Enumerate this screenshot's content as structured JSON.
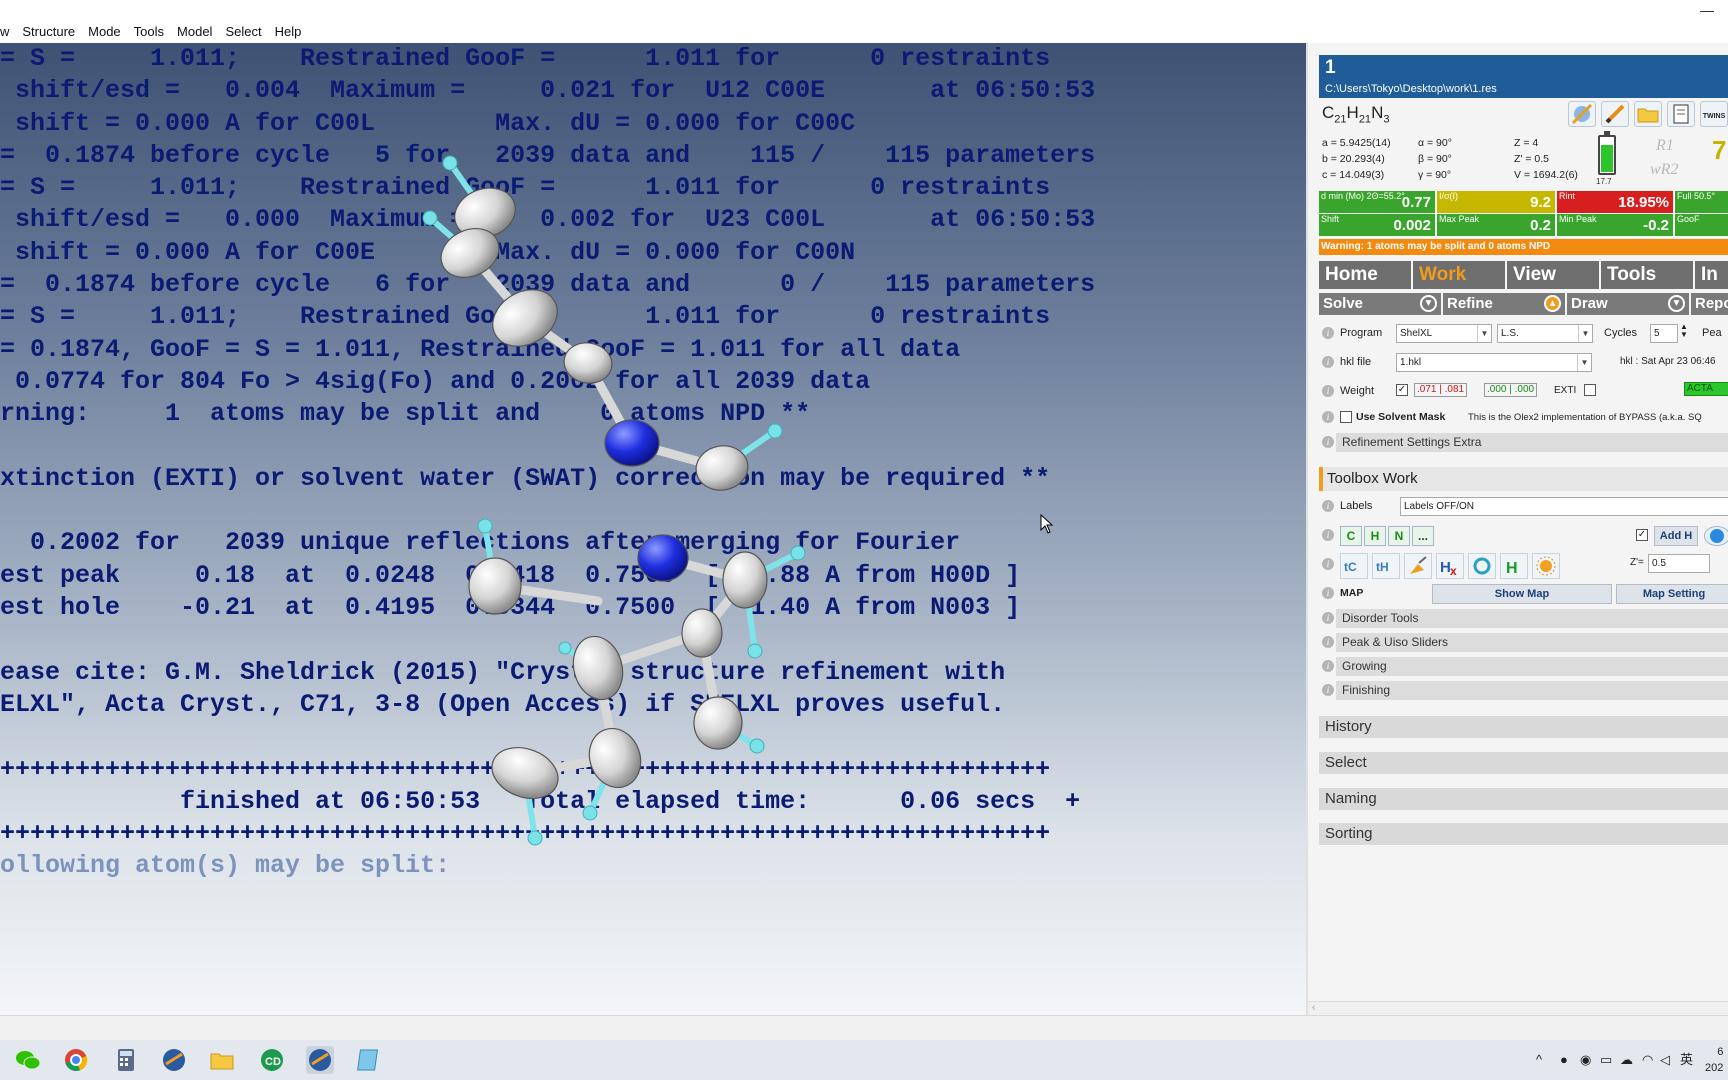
{
  "menu": {
    "items": [
      "w",
      "Structure",
      "Mode",
      "Tools",
      "Model",
      "Select",
      "Help"
    ]
  },
  "console": {
    "lines": [
      "= S =     1.011;    Restrained GooF =      1.011 for      0 restraints",
      " shift/esd =   0.004  Maximum =     0.021 for  U12 C00E       at 06:50:53",
      " shift = 0.000 A for C00L        Max. dU = 0.000 for C00C",
      "=  0.1874 before cycle   5 for   2039 data and    115 /    115 parameters",
      "= S =     1.011;    Restrained GooF =      1.011 for      0 restraints",
      " shift/esd =   0.000  Maximum =     0.002 for  U23 C00L       at 06:50:53",
      " shift = 0.000 A for C00E        Max. dU = 0.000 for C00N",
      "=  0.1874 before cycle   6 for   2039 data and      0 /    115 parameters",
      "= S =     1.011;    Restrained GooF =      1.011 for      0 restraints",
      "= 0.1874, GooF = S = 1.011, Restrained GooF = 1.011 for all data",
      " 0.0774 for 804 Fo > 4sig(Fo) and 0.2002 for all 2039 data",
      "rning:     1  atoms may be split and    0 atoms NPD **",
      "",
      "xtinction (EXTI) or solvent water (SWAT) correction may be required **",
      "",
      "  0.2002 for   2039 unique reflections after merging for Fourier",
      "est peak     0.18  at  0.0248  0.5418  0.7500  [  0.88 A from H00D ]",
      "est hole    -0.21  at  0.4195  0.5344  0.7500  [  1.40 A from N003 ]",
      "",
      "ease cite: G.M. Sheldrick (2015) \"Crystal structure refinement with",
      "ELXL\", Acta Cryst., C71, 3-8 (Open Access) if SHELXL proves useful.",
      "",
      "++++++++++++++++++++++++++++++++++++++++++++++++++++++++++++++++++++++",
      "            finished at 06:50:53   Total elapsed time:      0.06 secs  +",
      "++++++++++++++++++++++++++++++++++++++++++++++++++++++++++++++++++++++",
      "ollowing atom(s) may be split:"
    ]
  },
  "panel": {
    "number": "1",
    "path": "C:\\Users\\Tokyo\\Desktop\\work\\1.res",
    "formula": {
      "c": "21",
      "h": "21",
      "n": "3"
    },
    "cell": {
      "a": "a = 5.9425(14)",
      "alpha": "α = 90°",
      "z": "Z = 4",
      "b": "b = 20.293(4)",
      "beta": "β = 90°",
      "zp": "Z' = 0.5",
      "c": "c = 14.049(3)",
      "gamma": "γ = 90°",
      "v": "V = 1694.2(6)"
    },
    "battery_label": "17.7",
    "battery_level": 0.75,
    "r1_label": "R1",
    "wr2_label": "wR2",
    "r1_value": "7",
    "twins": "TWINS",
    "stats": {
      "dmin_label": "d min (Mo) 2Θ=55.2°",
      "dmin": "0.77",
      "isig_label": "I/σ(I)",
      "isig": "9.2",
      "rint_label": "Rint",
      "rint": "18.95%",
      "full_label": "Full 50.5°",
      "shift_label": "Shift",
      "shift": "0.002",
      "maxpeak_label": "Max Peak",
      "maxpeak": "0.2",
      "minpeak_label": "Min Peak",
      "minpeak": "-0.2",
      "goof_label": "GooF"
    },
    "colors": {
      "green": "#3aa52c",
      "yellow": "#c6b800",
      "red": "#d71f1f",
      "orange": "#f28a10",
      "header": "#1f5c98"
    },
    "warning": "Warning: 1 atoms may be split and 0 atoms NPD",
    "tabs": [
      "Home",
      "Work",
      "View",
      "Tools",
      "In"
    ],
    "active_tab": "Work",
    "subtabs": [
      "Solve",
      "Refine",
      "Draw",
      "Report"
    ],
    "program_label": "Program",
    "program": "ShelXL",
    "method": "L.S.",
    "cycles_label": "Cycles",
    "cycles": "5",
    "peaks_label": "Pea",
    "hkl_label": "hkl file",
    "hkl": "1.hkl",
    "hkl_date": "hkl : Sat Apr 23 06:46",
    "weight_label": "Weight",
    "weight_current": ".071 | .081",
    "weight_suggested": ".000 | .000",
    "exti_label": "EXTI",
    "acta": "ACTA",
    "solvent_mask_label": "Use Solvent Mask",
    "solvent_mask_desc": "This is the Olex2 implementation of BYPASS (a.k.a. SQ",
    "refinement_extra": "Refinement Settings Extra",
    "toolbox_title": "Toolbox Work",
    "labels_label": "Labels",
    "labels_value": "Labels OFF/ON",
    "elements": [
      "C",
      "H",
      "N",
      "..."
    ],
    "add_h": "Add H",
    "zeq_label": "Z'=",
    "zeq_value": "0.5",
    "map_label": "MAP",
    "show_map": "Show Map",
    "map_settings": "Map Setting",
    "tool_sections": [
      "Disorder Tools",
      "Peak & Uiso Sliders",
      "Growing",
      "Finishing"
    ],
    "collapsibles": [
      "History",
      "Select",
      "Naming",
      "Sorting"
    ]
  },
  "tray": {
    "ime": "英",
    "time": "6",
    "date": "202"
  }
}
